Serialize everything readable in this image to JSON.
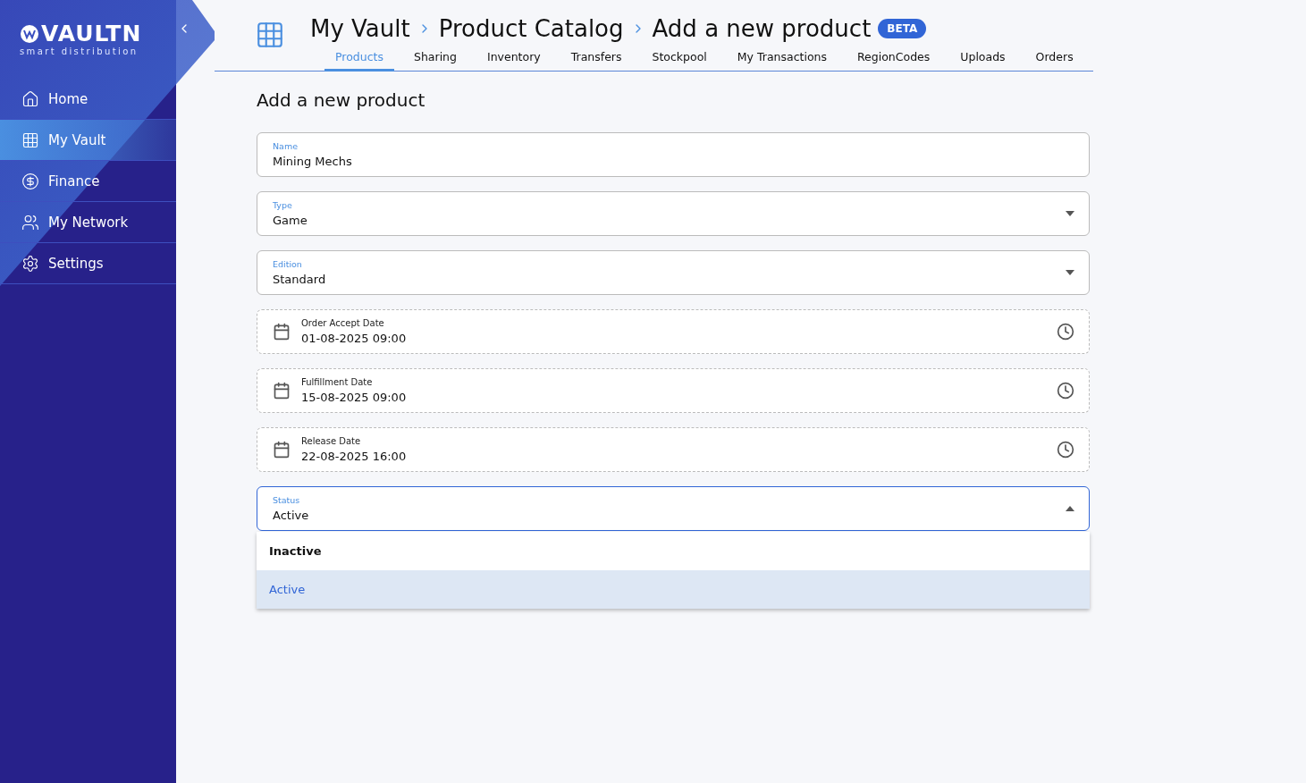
{
  "sidebar": {
    "logo": "VAULTN",
    "tagline": "smart distribution",
    "items": [
      {
        "label": "Home",
        "selected": false
      },
      {
        "label": "My Vault",
        "selected": true
      },
      {
        "label": "Finance",
        "selected": false
      },
      {
        "label": "My Network",
        "selected": false
      },
      {
        "label": "Settings",
        "selected": false
      }
    ]
  },
  "header": {
    "breadcrumb": [
      "My Vault",
      "Product Catalog",
      "Add a new product"
    ],
    "badge": "BETA",
    "tabs": [
      {
        "label": "Products",
        "selected": true
      },
      {
        "label": "Sharing",
        "selected": false
      },
      {
        "label": "Inventory",
        "selected": false
      },
      {
        "label": "Transfers",
        "selected": false
      },
      {
        "label": "Stockpool",
        "selected": false
      },
      {
        "label": "My Transactions",
        "selected": false
      },
      {
        "label": "RegionCodes",
        "selected": false
      },
      {
        "label": "Uploads",
        "selected": false
      },
      {
        "label": "Orders",
        "selected": false
      }
    ]
  },
  "form": {
    "title": "Add a new product",
    "fields": [
      {
        "kind": "text",
        "label": "Name",
        "value": "Mining Mechs"
      },
      {
        "kind": "select",
        "label": "Type",
        "value": "Game",
        "open": false
      },
      {
        "kind": "select",
        "label": "Edition",
        "value": "Standard",
        "open": false
      },
      {
        "kind": "date",
        "label": "Order Accept Date",
        "value": "01-08-2025 09:00"
      },
      {
        "kind": "date",
        "label": "Fulfillment Date",
        "value": "15-08-2025 09:00"
      },
      {
        "kind": "date",
        "label": "Release Date",
        "value": "22-08-2025 16:00"
      },
      {
        "kind": "select",
        "label": "Status",
        "value": "Active",
        "open": true,
        "options": [
          {
            "label": "Inactive",
            "selected": false
          },
          {
            "label": "Active",
            "selected": true
          }
        ]
      }
    ]
  }
}
